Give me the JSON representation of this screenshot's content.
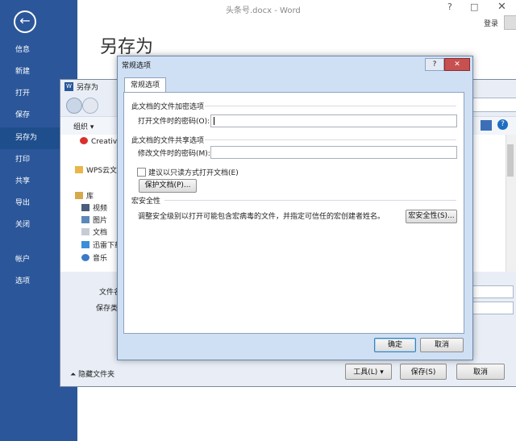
{
  "window": {
    "title": "头条号.docx - Word",
    "minimize": "?",
    "restore": "□",
    "close": "✕",
    "login": "登录"
  },
  "backstage": {
    "back": "←",
    "heading": "另存为",
    "items": [
      {
        "label": "信息"
      },
      {
        "label": "新建"
      },
      {
        "label": "打开"
      },
      {
        "label": "保存"
      },
      {
        "label": "另存为",
        "active": true
      },
      {
        "label": "打印"
      },
      {
        "label": "共享"
      },
      {
        "label": "导出"
      },
      {
        "label": "关闭"
      },
      {
        "label": "帐户"
      },
      {
        "label": "选项"
      }
    ]
  },
  "saveas": {
    "title": "另存为",
    "word_icon": "W",
    "organize": "组织 ▾",
    "help": "?",
    "nav": [
      {
        "label": "Creative",
        "icon": "creative-cloud-icon"
      },
      {
        "label": "WPS云文档",
        "icon": "folder-icon"
      },
      {
        "label": "库",
        "icon": "library-icon"
      },
      {
        "label": "视频",
        "icon": "video-icon"
      },
      {
        "label": "图片",
        "icon": "picture-icon"
      },
      {
        "label": "文档",
        "icon": "document-icon"
      },
      {
        "label": "迅雷下载",
        "icon": "thunder-download-icon"
      },
      {
        "label": "音乐",
        "icon": "music-icon"
      }
    ],
    "filename_label": "文件名",
    "filetype_label": "保存类型",
    "hide_folders": "隐藏文件夹",
    "tools_btn": "工具(L)",
    "save_btn": "保存(S)",
    "cancel_btn": "取消"
  },
  "options_dialog": {
    "title": "常规选项",
    "help": "?",
    "close": "✕",
    "tab": "常规选项",
    "encrypt_section": "此文档的文件加密选项",
    "open_password_label": "打开文件时的密码(O):",
    "open_password_value": "",
    "share_section": "此文档的文件共享选项",
    "modify_password_label": "修改文件时的密码(M):",
    "modify_password_value": "",
    "readonly_checkbox": "建议以只读方式打开文档(E)",
    "readonly_checked": false,
    "protect_btn": "保护文档(P)...",
    "macro_section": "宏安全性",
    "macro_text": "调整安全级别以打开可能包含宏病毒的文件，并指定可信任的宏创建者姓名。",
    "macro_btn": "宏安全性(S)...",
    "ok_btn": "确定",
    "cancel_btn": "取消"
  },
  "colors": {
    "word_blue": "#2b579a",
    "dialog_frame": "#cfe0f4"
  }
}
